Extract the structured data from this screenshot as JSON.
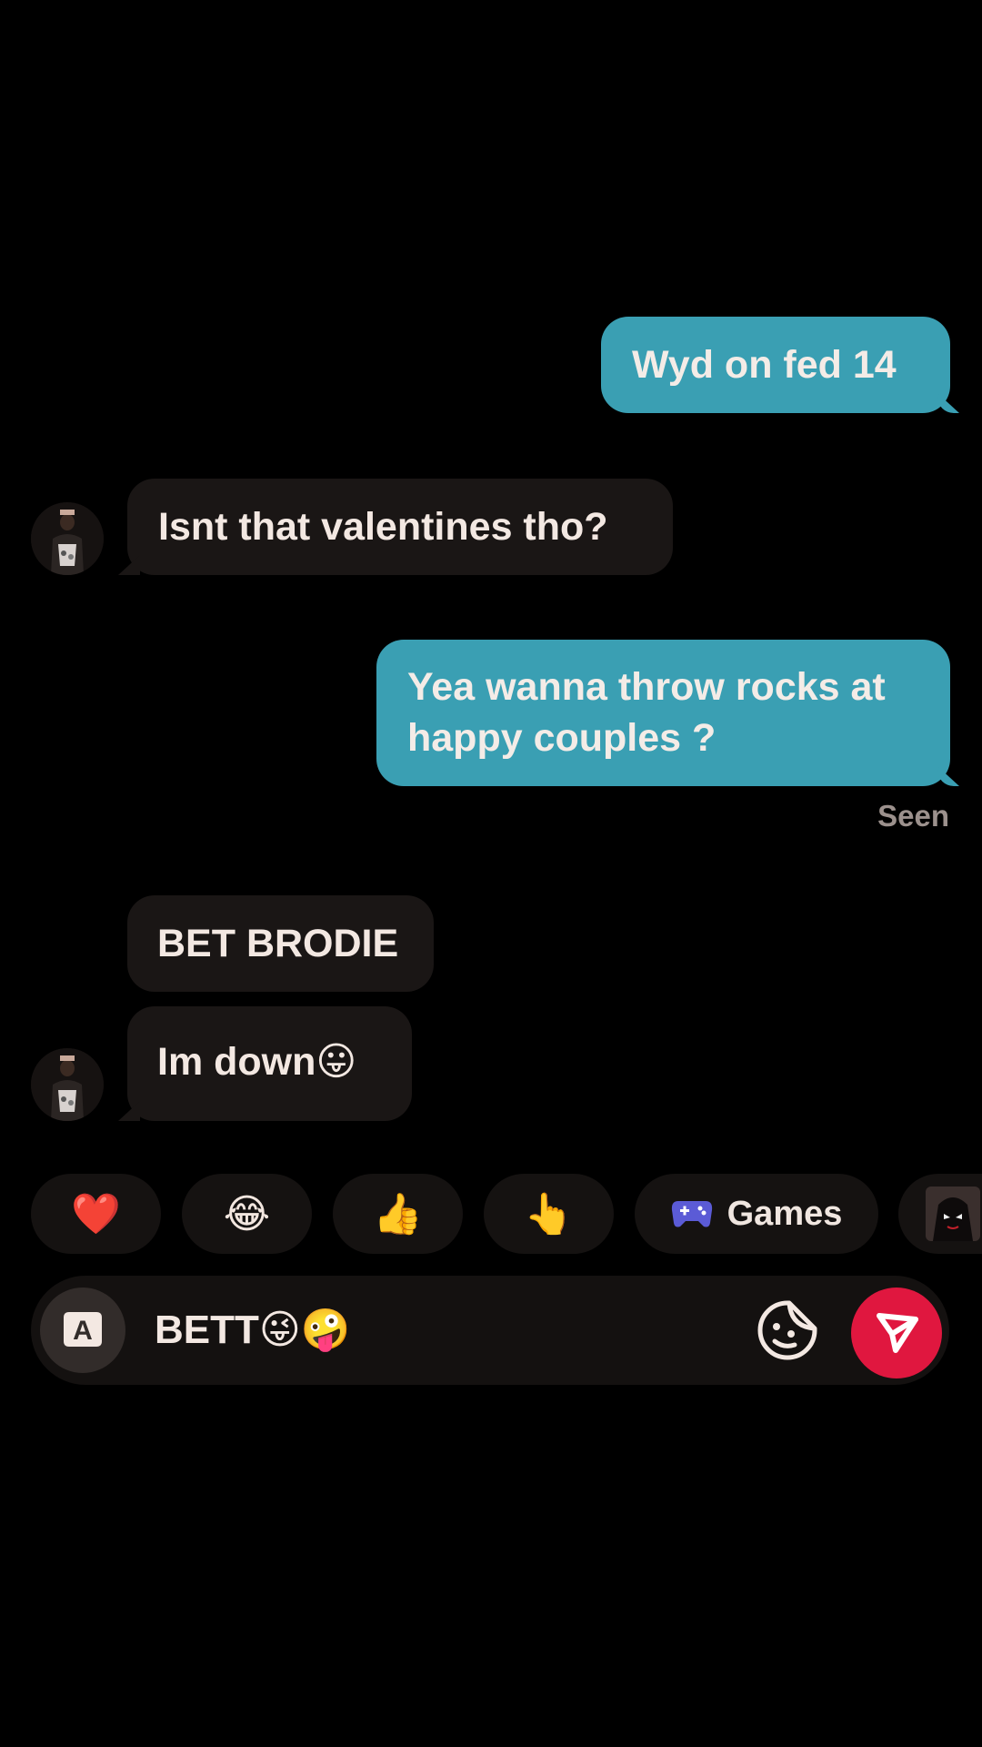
{
  "messages": [
    {
      "id": "m1",
      "direction": "outgoing",
      "text": "Wyd on fed 14"
    },
    {
      "id": "m2",
      "direction": "incoming",
      "text": "Isnt that valentines tho?"
    },
    {
      "id": "m3",
      "direction": "outgoing",
      "text_line1": "Yea wanna throw rocks at",
      "text_line2": "happy couples ?"
    },
    {
      "id": "m4",
      "direction": "incoming",
      "text": "BET BRODIE"
    },
    {
      "id": "m5",
      "direction": "incoming",
      "text": "Im down",
      "emoji": "😛"
    }
  ],
  "status": {
    "seen_label": "Seen"
  },
  "quick_reactions": [
    {
      "emoji": "❤️",
      "icon": "heart-icon"
    },
    {
      "emoji": "😂",
      "icon": "tears-of-joy-icon"
    },
    {
      "emoji": "👍",
      "icon": "thumbs-up-icon"
    },
    {
      "emoji": "👆",
      "icon": "pointing-up-icon"
    }
  ],
  "games_chip": {
    "label": "Games",
    "icon": "gamepad-icon"
  },
  "composer": {
    "text": "BETT",
    "emojis": "😜🤪",
    "keyboard_icon_letter": "A"
  },
  "colors": {
    "outgoing_bubble": "#3a9fb3",
    "incoming_bubble": "#1a1615",
    "send_button": "#e0173f",
    "background": "#000000"
  }
}
